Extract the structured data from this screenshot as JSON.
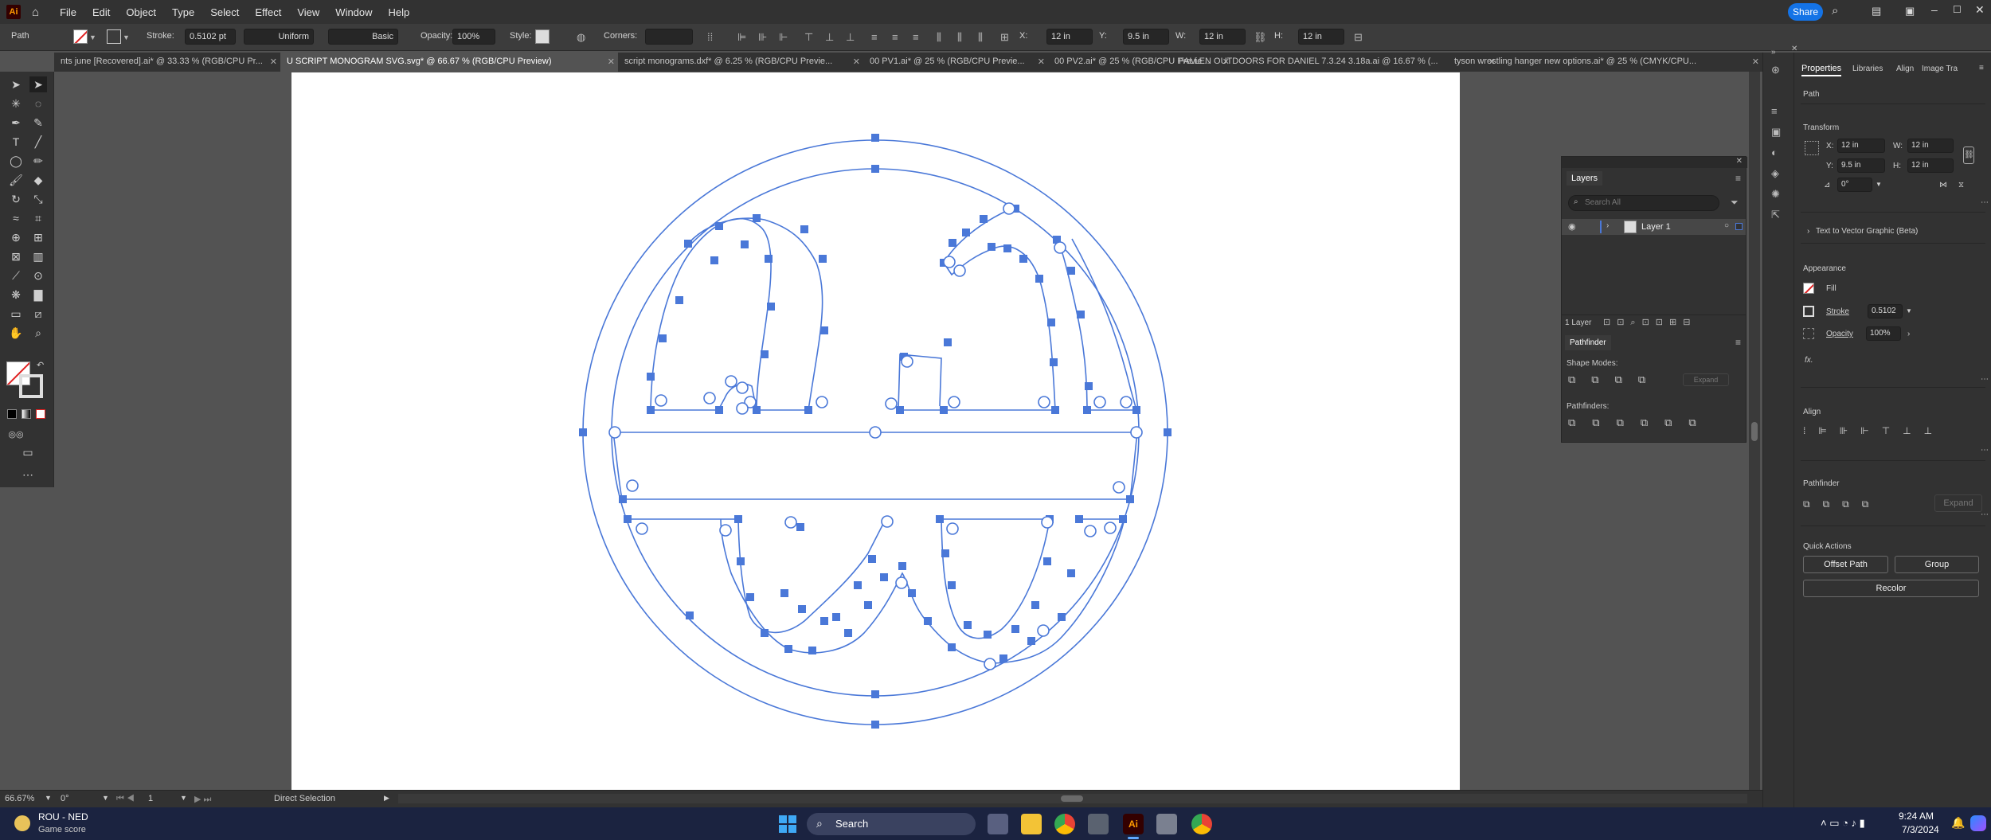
{
  "app": {
    "logo": "Ai",
    "home_icon": "home-icon"
  },
  "menu": [
    "File",
    "Edit",
    "Object",
    "Type",
    "Select",
    "Effect",
    "View",
    "Window",
    "Help"
  ],
  "window_controls": {
    "share_label": "Share"
  },
  "control_bar": {
    "selection_label": "Path",
    "stroke_label": "Stroke:",
    "stroke_value": "0.5102 pt",
    "profile_value": "Uniform",
    "brush_value": "Basic",
    "opacity_label": "Opacity:",
    "opacity_value": "100%",
    "style_label": "Style:",
    "corners_label": "Corners:",
    "x_label": "X:",
    "x_value": "12 in",
    "y_label": "Y:",
    "y_value": "9.5 in",
    "w_label": "W:",
    "w_value": "12 in",
    "h_label": "H:",
    "h_value": "12 in"
  },
  "tabs": [
    {
      "label": "nts june [Recovered].ai* @ 33.33 % (RGB/CPU Pr...",
      "active": false
    },
    {
      "label": "U SCRIPT MONOGRAM SVG.svg* @ 66.67 % (RGB/CPU Preview)",
      "active": true
    },
    {
      "label": "script monograms.dxf* @ 6.25 % (RGB/CPU Previe...",
      "active": false
    },
    {
      "label": "00 PV1.ai* @ 25 % (RGB/CPU Previe...",
      "active": false
    },
    {
      "label": "00 PV2.ai* @ 25 % (RGB/CPU Previe...",
      "active": false
    },
    {
      "label": "FALLEN OUTDOORS FOR DANIEL 7.3.24 3.18a.ai @ 16.67 % (...",
      "active": false
    },
    {
      "label": "tyson wrestling hanger new options.ai* @ 25 % (CMYK/CPU...",
      "active": false
    }
  ],
  "status": {
    "zoom": "66.67%",
    "rotate": "0°",
    "artboard": "1",
    "tool": "Direct Selection"
  },
  "layers": {
    "title": "Layers",
    "search_placeholder": "Search All",
    "layer_name": "Layer 1",
    "count": "1 Layer"
  },
  "pathfinder_panel": {
    "title": "Pathfinder",
    "shape_modes": "Shape Modes:",
    "expand": "Expand",
    "pathfinders": "Pathfinders:"
  },
  "properties": {
    "tabs": [
      "Properties",
      "Libraries",
      "Align",
      "Image Tra"
    ],
    "kind": "Path",
    "transform": "Transform",
    "x_label": "X:",
    "x": "12 in",
    "y_label": "Y:",
    "y": "9.5 in",
    "w_label": "W:",
    "w": "12 in",
    "h_label": "H:",
    "h": "12 in",
    "angle": "0°",
    "vector": "Text to Vector Graphic (Beta)",
    "appearance": "Appearance",
    "fill": "Fill",
    "stroke": "Stroke",
    "stroke_value": "0.5102",
    "opacity": "Opacity",
    "opacity_value": "100%",
    "fx": "fx.",
    "align": "Align",
    "pathfinder": "Pathfinder",
    "pf_expand": "Expand",
    "quick_actions": "Quick Actions",
    "offset_path": "Offset Path",
    "group": "Group",
    "recolor": "Recolor"
  },
  "taskbar": {
    "weather_title": "ROU - NED",
    "weather_sub": "Game score",
    "search": "Search",
    "time": "9:24 AM",
    "date": "7/3/2024"
  },
  "colors": {
    "path": "#4a78d8",
    "artboard": "#ffffff",
    "accent": "#1473e6"
  }
}
